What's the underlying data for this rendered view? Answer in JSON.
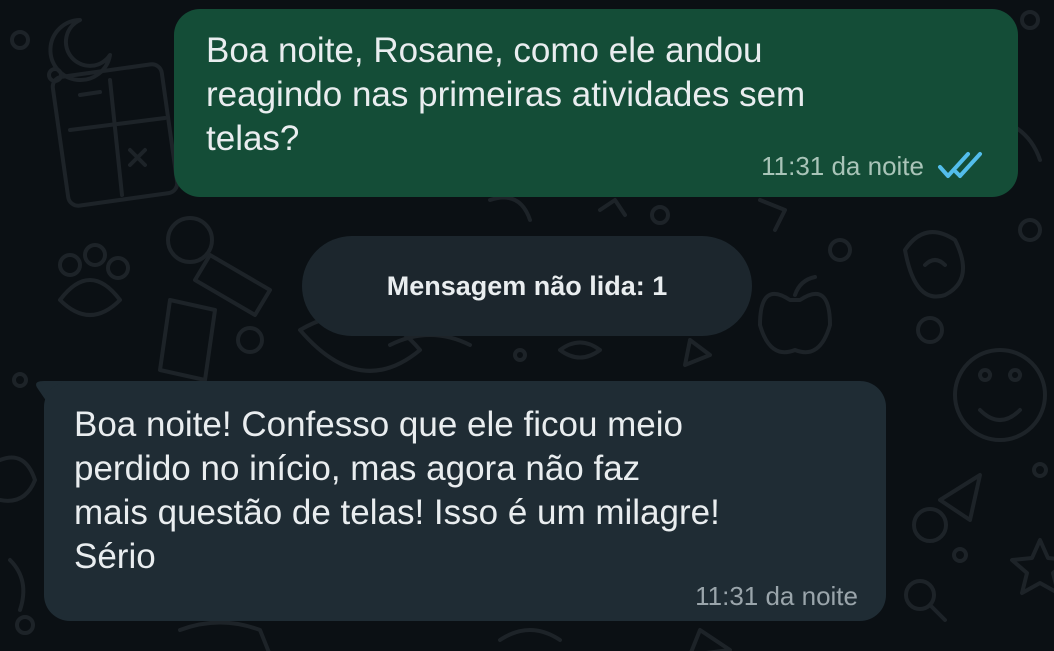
{
  "conversation": {
    "outgoing": {
      "text": "Boa noite, Rosane, como ele andou\nreagindo nas primeiras atividades sem\ntelas?",
      "time": "11:31 da noite",
      "status_icon": "double-check-read-icon",
      "status_color": "#53bdeb",
      "bubble_color": "#144d37"
    },
    "unread_divider": {
      "label": "Mensagem não lida: 1"
    },
    "incoming": {
      "text": "Boa noite! Confesso que ele ficou meio\nperdido no início, mas agora não faz\nmais questão de telas! Isso é um milagre!\nSério",
      "time": "11:31 da noite",
      "bubble_color": "#1f2c34"
    }
  },
  "wallpaper": {
    "background_color": "#0b1014",
    "doodle_color": "#1c2227"
  }
}
